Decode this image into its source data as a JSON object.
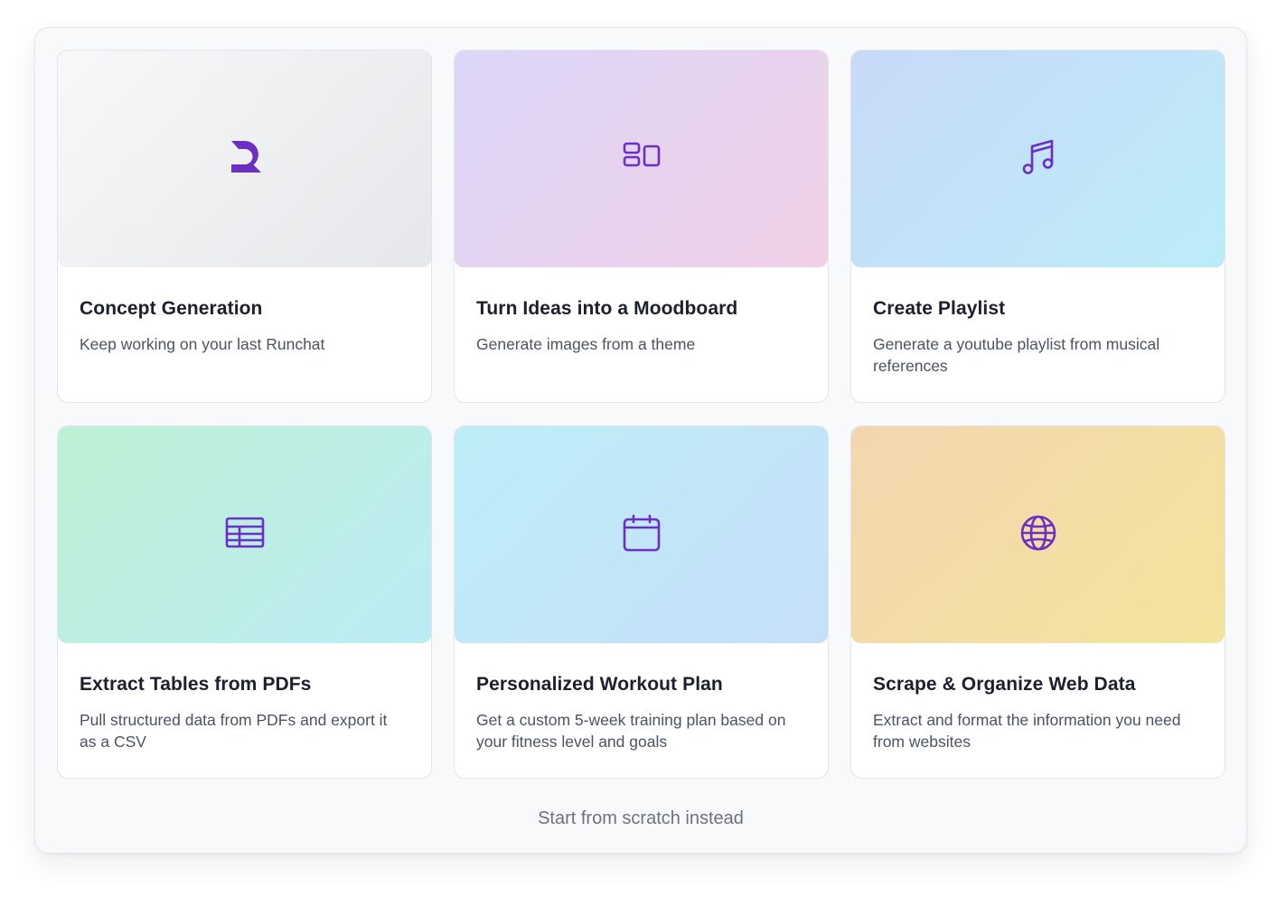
{
  "cards": [
    {
      "title": "Concept Generation",
      "description": "Keep working on your last Runchat",
      "icon": "runchat-logo-icon",
      "gradient": [
        "#f8f8f9",
        "#e6e7ea"
      ]
    },
    {
      "title": "Turn Ideas into a Moodboard",
      "description": "Generate images from a theme",
      "icon": "layout-grid-icon",
      "gradient": [
        "#dcd6f8",
        "#f0d0e6"
      ]
    },
    {
      "title": "Create Playlist",
      "description": "Generate a youtube playlist from musical references",
      "icon": "music-note-icon",
      "gradient": [
        "#c8d9f8",
        "#bcedf8"
      ]
    },
    {
      "title": "Extract Tables from PDFs",
      "description": "Pull structured data from PDFs and export it as a CSV",
      "icon": "table-icon",
      "gradient": [
        "#bef0d4",
        "#bbecf5"
      ]
    },
    {
      "title": "Personalized Workout Plan",
      "description": "Get a custom 5-week training plan based on your fitness level and goals",
      "icon": "calendar-icon",
      "gradient": [
        "#bdeef8",
        "#c6dff8"
      ]
    },
    {
      "title": "Scrape & Organize Web Data",
      "description": "Extract and format the information you need from websites",
      "icon": "globe-icon",
      "gradient": [
        "#f3d6b0",
        "#f3e49c"
      ]
    }
  ],
  "footer": {
    "link_label": "Start from scratch instead"
  },
  "colors": {
    "icon_accent": "#6b2fc4",
    "panel_background": "#f8f9fb",
    "title_text": "#1b1f2e",
    "description_text": "#4b5263",
    "footer_text": "#6b7180"
  }
}
